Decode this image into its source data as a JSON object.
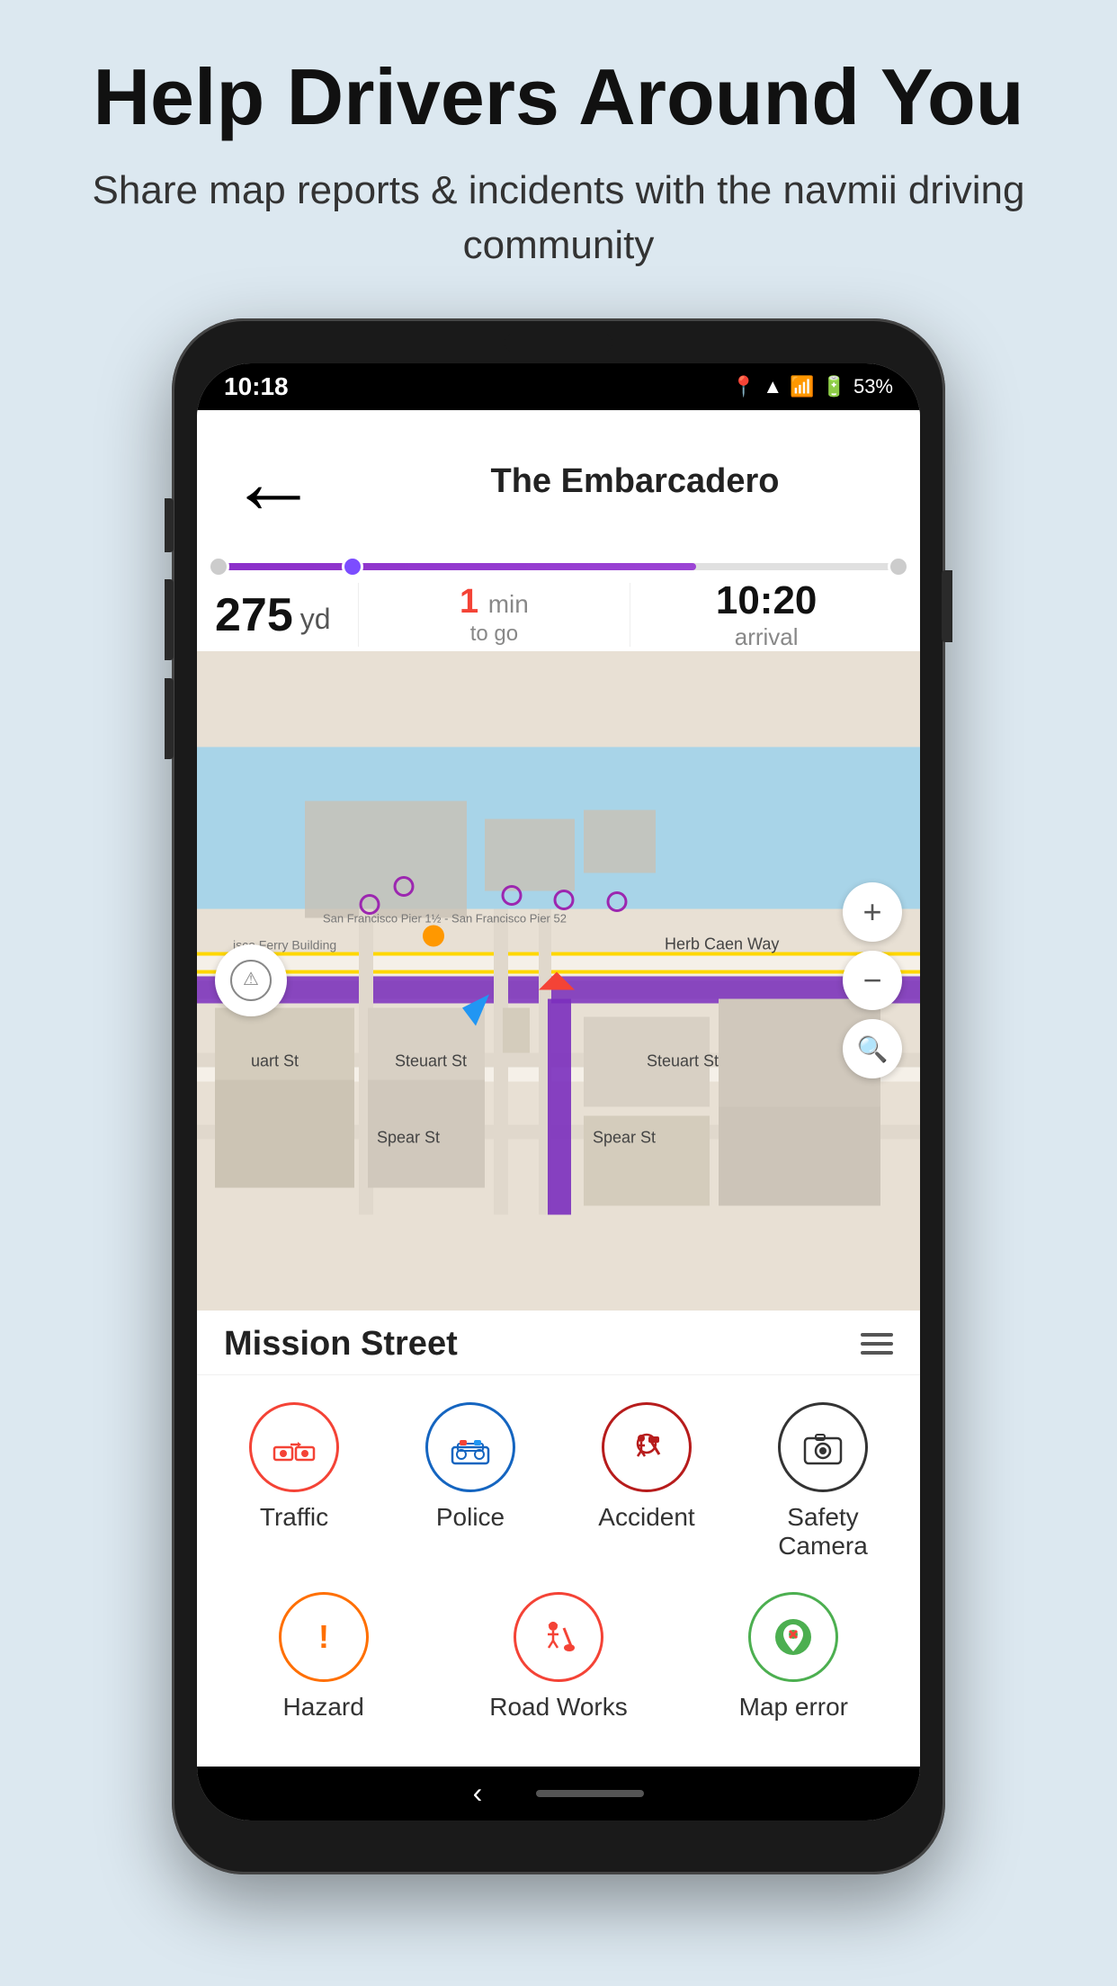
{
  "page": {
    "title": "Help Drivers Around You",
    "subtitle": "Share map reports & incidents with the navmii driving community"
  },
  "status_bar": {
    "time": "10:18",
    "battery": "53%"
  },
  "navigation": {
    "street_name": "The Embarcadero",
    "distance": "275",
    "unit": "yd",
    "time_to_go": "1 min",
    "time_to_go_label": "to go",
    "arrival_time": "10:20",
    "arrival_label": "arrival"
  },
  "map": {
    "zoom_in_label": "+",
    "zoom_out_label": "−",
    "search_label": "🔍"
  },
  "bottom_panel": {
    "street": "Mission Street",
    "report_items_row1": [
      {
        "label": "Traffic",
        "icon": "🚗",
        "color": "icon-red"
      },
      {
        "label": "Police",
        "icon": "🚔",
        "color": "icon-blue"
      },
      {
        "label": "Accident",
        "icon": "🚧",
        "color": "icon-dark-red"
      },
      {
        "label": "Safety Camera",
        "icon": "📷",
        "color": "icon-dark"
      }
    ],
    "report_items_row2": [
      {
        "label": "Hazard",
        "icon": "❗",
        "color": "icon-orange"
      },
      {
        "label": "Road Works",
        "icon": "👷",
        "color": "icon-red"
      },
      {
        "label": "Map error",
        "icon": "📍",
        "color": "icon-green"
      }
    ]
  }
}
